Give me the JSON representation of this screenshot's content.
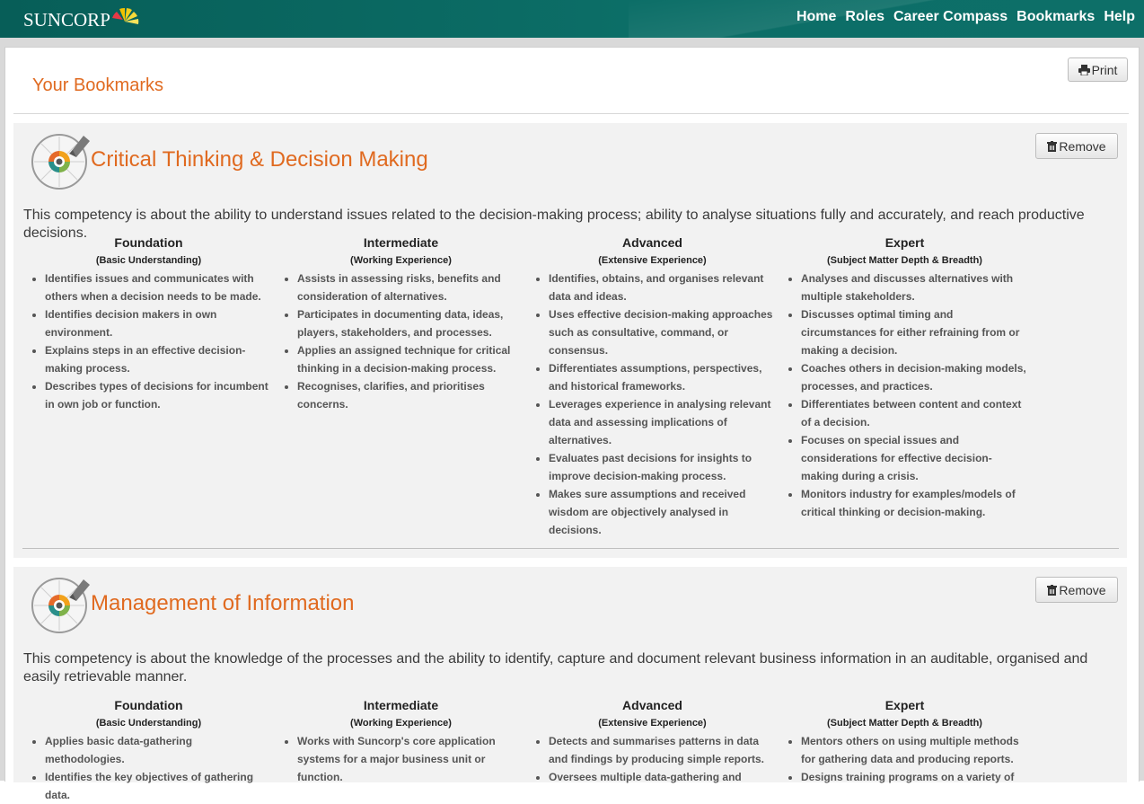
{
  "header": {
    "brand": "SUNCORP",
    "nav": [
      "Home",
      "Roles",
      "Career Compass",
      "Bookmarks",
      "Help"
    ]
  },
  "page": {
    "title": "Your Bookmarks",
    "print_label": "Print"
  },
  "competencies": [
    {
      "title": "Critical Thinking & Decision Making",
      "remove_label": "Remove",
      "description": "This competency is about the ability to understand issues related to the decision-making process; ability to analyse situations fully and accurately, and reach productive decisions.",
      "levels": [
        {
          "name": "Foundation",
          "subtitle": "(Basic Understanding)",
          "items": [
            "Identifies issues and communicates with others when a decision needs to be made.",
            "Identifies decision makers in own environment.",
            "Explains steps in an effective decision-making process.",
            "Describes types of decisions for incumbent in own job or function."
          ]
        },
        {
          "name": "Intermediate",
          "subtitle": "(Working Experience)",
          "items": [
            "Assists in assessing risks, benefits and consideration of alternatives.",
            "Participates in documenting data, ideas, players, stakeholders, and processes.",
            "Applies an assigned technique for critical thinking in a decision-making process.",
            "Recognises, clarifies, and prioritises concerns."
          ]
        },
        {
          "name": "Advanced",
          "subtitle": "(Extensive Experience)",
          "items": [
            "Identifies, obtains, and organises relevant data and ideas.",
            "Uses effective decision-making approaches such as consultative, command, or consensus.",
            "Differentiates assumptions, perspectives, and historical frameworks.",
            "Leverages experience in analysing relevant data and assessing implications of alternatives.",
            "Evaluates past decisions for insights to improve decision-making process.",
            "Makes sure assumptions and received wisdom are objectively analysed in decisions."
          ]
        },
        {
          "name": "Expert",
          "subtitle": "(Subject Matter Depth & Breadth)",
          "items": [
            "Analyses and discusses alternatives with multiple stakeholders.",
            "Discusses optimal timing and circumstances for either refraining from or making a decision.",
            "Coaches others in decision-making models, processes, and practices.",
            "Differentiates between content and context of a decision.",
            "Focuses on special issues and considerations for effective decision-making during a crisis.",
            "Monitors industry for examples/models of critical thinking or decision-making."
          ]
        }
      ]
    },
    {
      "title": "Management of Information",
      "remove_label": "Remove",
      "description": "This competency is about the knowledge of the processes and the ability to identify, capture and document relevant business information in an auditable, organised and easily retrievable manner.",
      "levels": [
        {
          "name": "Foundation",
          "subtitle": "(Basic Understanding)",
          "items": [
            "Applies basic data-gathering methodologies.",
            "Identifies the key objectives of gathering data."
          ]
        },
        {
          "name": "Intermediate",
          "subtitle": "(Working Experience)",
          "items": [
            "Works with Suncorp's core application systems for a major business unit or function."
          ]
        },
        {
          "name": "Advanced",
          "subtitle": "(Extensive Experience)",
          "items": [
            "Detects and summarises patterns in data and findings by producing simple reports.",
            "Oversees multiple data-gathering and"
          ]
        },
        {
          "name": "Expert",
          "subtitle": "(Subject Matter Depth & Breadth)",
          "items": [
            "Mentors others on using multiple methods for gathering data and producing reports.",
            "Designs training programs on a variety of"
          ]
        }
      ]
    }
  ]
}
